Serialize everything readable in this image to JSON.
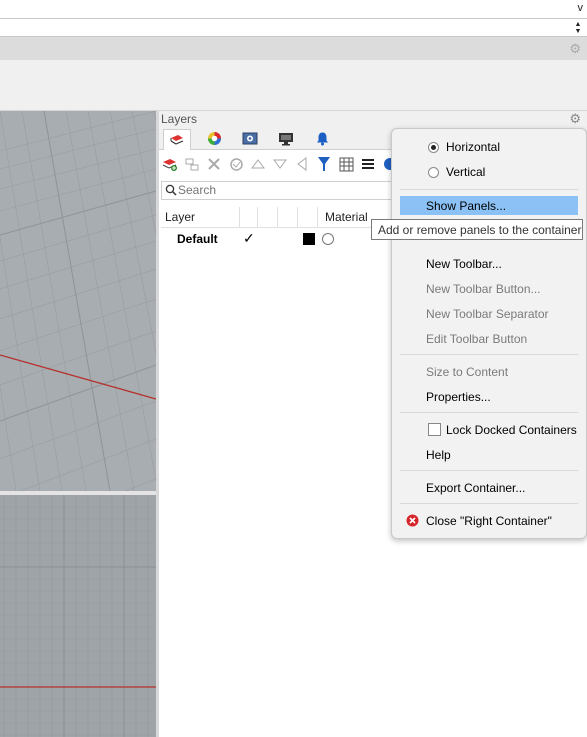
{
  "command": {
    "dropdown_glyph": "v",
    "spinner_up": "▲",
    "spinner_down": "▼"
  },
  "layers_panel": {
    "title": "Layers",
    "search_placeholder": "Search",
    "columns": {
      "layer": "Layer",
      "material": "Material"
    },
    "rows": [
      {
        "name": "Default",
        "current": "✓",
        "color": "#000000"
      }
    ],
    "tabs": [
      "layers-icon",
      "materials-icon",
      "display-mode-icon",
      "viewport-icon",
      "notifications-icon"
    ],
    "tools": [
      "new-layer-icon",
      "new-sublayer-icon",
      "delete-icon",
      "purge-icon",
      "move-up-icon",
      "move-down-icon",
      "filter-left-icon",
      "filter-icon",
      "table-icon",
      "list-icon"
    ]
  },
  "context_menu": {
    "horizontal": "Horizontal",
    "vertical": "Vertical",
    "orientation_selected": "Horizontal",
    "show_panels": "Show Panels...",
    "new_toolbar": "New Toolbar...",
    "new_toolbar_button": "New Toolbar Button...",
    "new_toolbar_separator": "New Toolbar Separator",
    "edit_toolbar_button": "Edit Toolbar Button",
    "size_to_content": "Size to Content",
    "properties": "Properties...",
    "lock_docked": "Lock Docked Containers",
    "help": "Help",
    "export_container": "Export Container...",
    "close_container": "Close \"Right Container\""
  },
  "tooltip": {
    "text": "Add or remove panels to the container"
  },
  "colors": {
    "highlight": "#8cc1f5",
    "viewport_bg": "#a8adb2",
    "axis_red": "#b5302b",
    "close_red": "#d6262b"
  }
}
